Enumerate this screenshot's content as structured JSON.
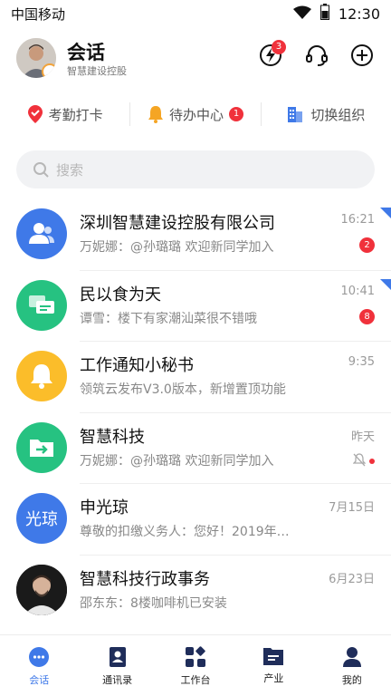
{
  "status_bar": {
    "carrier": "中国移动",
    "time": "12:30"
  },
  "header": {
    "title": "会话",
    "subtitle": "智慧建设控股",
    "notification_count": "3"
  },
  "quick_actions": [
    {
      "label": "考勤打卡",
      "icon": "location-pin-icon"
    },
    {
      "label": "待办中心",
      "icon": "bell-icon",
      "badge": "1"
    },
    {
      "label": "切换组织",
      "icon": "building-switch-icon"
    }
  ],
  "search": {
    "placeholder": "搜索"
  },
  "conversations": [
    {
      "name": "深圳智慧建设控股有限公司",
      "preview": "万妮娜：@孙璐璐 欢迎新同学加入",
      "time": "16:21",
      "unread": "2",
      "avatar_color": "#3f79e8",
      "icon": "group-icon"
    },
    {
      "name": "民以食为天",
      "preview": "谭雪：楼下有家潮汕菜很不错哦",
      "time": "10:41",
      "unread": "8",
      "avatar_color": "#26c281",
      "icon": "chat-group-icon"
    },
    {
      "name": "工作通知小秘书",
      "preview": "领筑云发布V3.0版本，新增置顶功能",
      "time": "9:35",
      "avatar_color": "#fbbd2a",
      "icon": "bell-icon"
    },
    {
      "name": "智慧科技",
      "preview": "万妮娜：@孙璐璐 欢迎新同学加入",
      "time": "昨天",
      "avatar_color": "#26c281",
      "icon": "folder-share-icon"
    },
    {
      "name": "申光琼",
      "preview": "尊敬的扣缴义务人：您好！2019年…",
      "time": "7月15日",
      "avatar_color": "#3f79e8",
      "avatar_text": "光琼"
    },
    {
      "name": "智慧科技行政事务",
      "preview": "邵东东：8楼咖啡机已安装",
      "time": "6月23日",
      "avatar_color": "#1a1a1a",
      "icon": "person-photo"
    }
  ],
  "tabs": [
    {
      "label": "会话",
      "icon": "chat-icon",
      "active": true
    },
    {
      "label": "通讯录",
      "icon": "contacts-icon"
    },
    {
      "label": "工作台",
      "icon": "workbench-icon"
    },
    {
      "label": "产业",
      "icon": "folder-icon"
    },
    {
      "label": "我的",
      "icon": "profile-icon"
    }
  ],
  "colors": {
    "accent": "#3f79e8",
    "badge": "#f0313b",
    "green": "#26c281",
    "yellow": "#fbbd2a"
  }
}
